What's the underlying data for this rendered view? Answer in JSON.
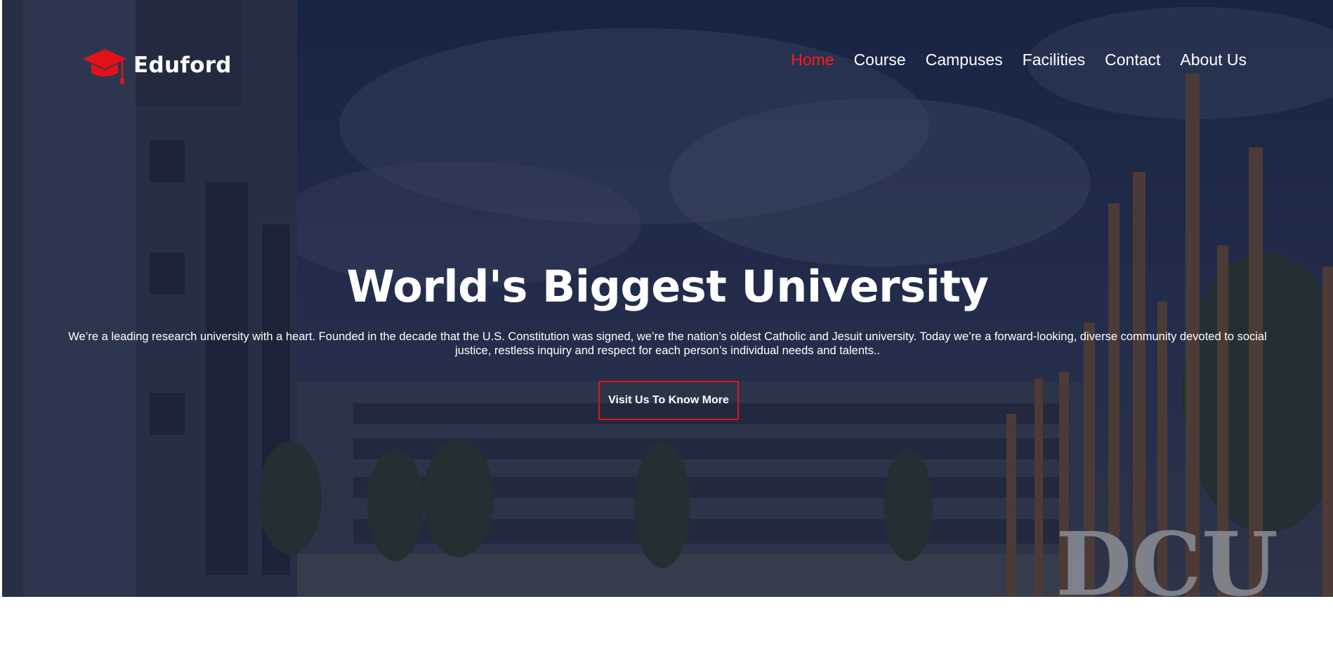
{
  "brand": {
    "name": "Eduford",
    "icon": "graduation-cap-icon",
    "accent_color": "#e3121a"
  },
  "nav": {
    "items": [
      {
        "label": "Home",
        "active": true
      },
      {
        "label": "Course",
        "active": false
      },
      {
        "label": "Campuses",
        "active": false
      },
      {
        "label": "Facilities",
        "active": false
      },
      {
        "label": "Contact",
        "active": false
      },
      {
        "label": "About Us",
        "active": false
      }
    ]
  },
  "hero": {
    "title": "World's Biggest University",
    "description": "We’re a leading research university with a heart. Founded in the decade that the U.S. Constitution was signed, we’re the nation’s oldest Catholic and Jesuit university. Today we’re a forward-looking, diverse community devoted to social justice, restless inquiry and respect for each person’s individual needs and talents..",
    "cta_label": "Visit Us To Know More",
    "background": "campus-building-photo",
    "sign_text": "DCU"
  }
}
